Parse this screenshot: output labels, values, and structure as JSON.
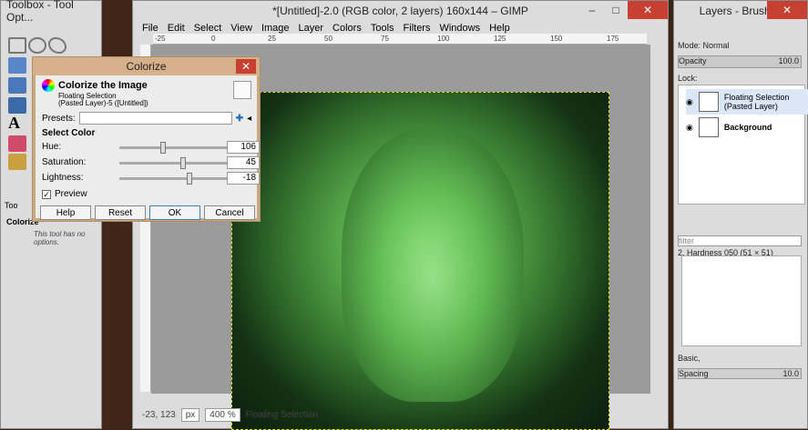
{
  "toolbox": {
    "title": "Toolbox - Tool Opt...",
    "tool_label": "Too",
    "panel_label": "Colorize",
    "no_options": "This tool has no options."
  },
  "gimp": {
    "title": "*[Untitled]-2.0 (RGB color, 2 layers) 160x144 – GIMP",
    "menu": [
      "File",
      "Edit",
      "Select",
      "View",
      "Image",
      "Layer",
      "Colors",
      "Tools",
      "Filters",
      "Windows",
      "Help"
    ],
    "ruler_ticks": [
      "-25",
      "0",
      "25",
      "50",
      "75",
      "100",
      "125",
      "150",
      "175"
    ],
    "status": {
      "coords": "-23, 123",
      "unit": "px",
      "zoom": "400 %",
      "message": "Floating Selection"
    }
  },
  "colorize": {
    "title": "Colorize",
    "header": "Colorize the Image",
    "sub1": "Floating Selection",
    "sub2": "(Pasted Layer)-5 ([Untitled])",
    "presets_label": "Presets:",
    "section": "Select Color",
    "hue_label": "Hue:",
    "hue": "106",
    "sat_label": "Saturation:",
    "sat": "45",
    "light_label": "Lightness:",
    "light": "-18",
    "preview": "Preview",
    "help": "Help",
    "reset": "Reset",
    "ok": "OK",
    "cancel": "Cancel"
  },
  "dock": {
    "title": "Layers - Brushes",
    "mode_label": "Mode:",
    "mode": "Normal",
    "opacity_label": "Opacity",
    "opacity": "100.0",
    "lock_label": "Lock:",
    "layers": [
      {
        "name": "Floating Selection\n(Pasted Layer)"
      },
      {
        "name": "Background"
      }
    ],
    "filter_placeholder": "filter",
    "brush_name": "2. Hardness 050 (51 × 51)",
    "brush_set": "Basic,",
    "spacing_label": "Spacing",
    "spacing": "10.0"
  }
}
